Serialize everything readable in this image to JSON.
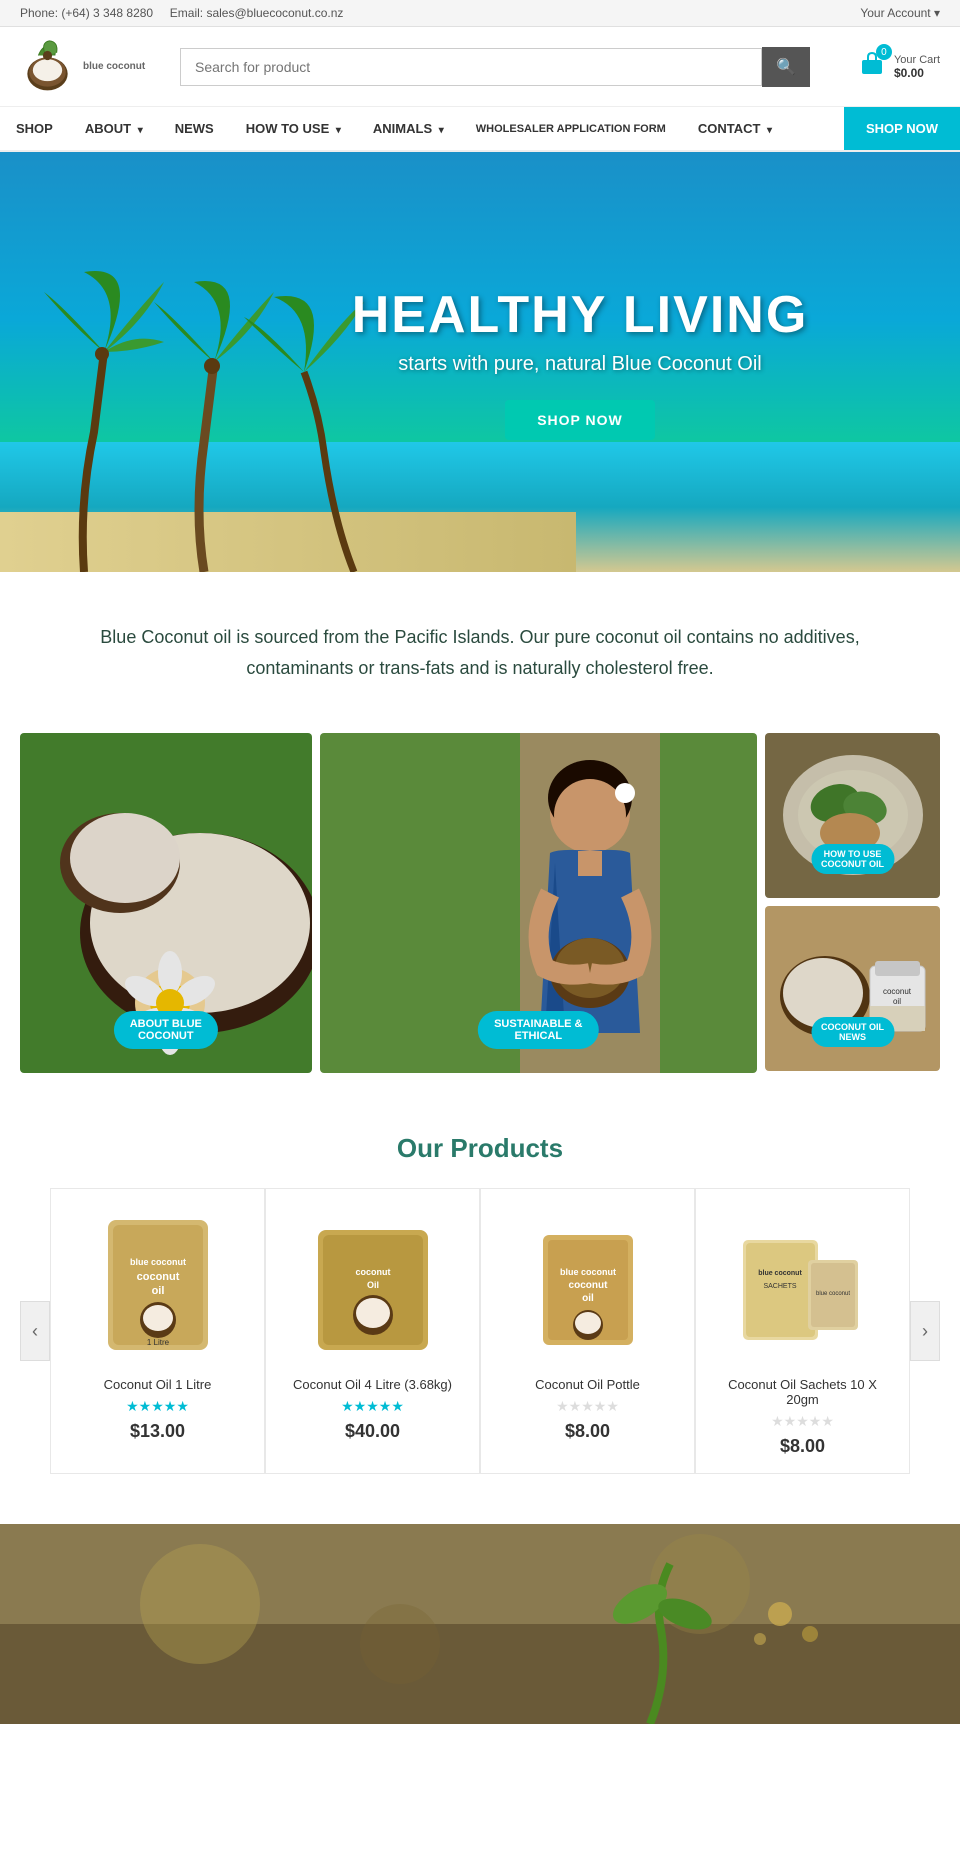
{
  "topbar": {
    "phone": "Phone: (+64) 3 348 8280",
    "email": "Email: sales@bluecoconut.co.nz",
    "account": "Your Account ▾"
  },
  "header": {
    "logo_line1": "blue coconut",
    "cart_label": "Your Cart",
    "cart_amount": "$0.00",
    "cart_count": "0",
    "search_placeholder": "Search for product"
  },
  "nav": {
    "items": [
      {
        "label": "SHOP",
        "has_arrow": false
      },
      {
        "label": "ABOUT",
        "has_arrow": true
      },
      {
        "label": "NEWS",
        "has_arrow": false
      },
      {
        "label": "HOW TO USE",
        "has_arrow": true
      },
      {
        "label": "ANIMALS",
        "has_arrow": true
      },
      {
        "label": "WHOLESALER APPLICATION FORM",
        "has_arrow": false
      },
      {
        "label": "CONTACT",
        "has_arrow": true
      }
    ],
    "shop_now": "SHOP NOW"
  },
  "hero": {
    "title": "HEALTHY LIVING",
    "subtitle": "starts with pure, natural Blue Coconut Oil",
    "button": "SHOP NOW"
  },
  "about": {
    "text": "Blue Coconut oil is sourced from the Pacific Islands. Our pure coconut oil contains no additives, contaminants or trans-fats and is naturally cholesterol free."
  },
  "grid_labels": {
    "about": "ABOUT BLUE\nCOCONUT",
    "sustainable": "SUSTAINABLE &\nETHICAL",
    "how_to_use": "HOW TO USE\nCOCONUT OIL",
    "news": "COCONUT OIL\nNEWS"
  },
  "products": {
    "title": "Our Products",
    "items": [
      {
        "name": "Coconut Oil 1 Litre",
        "price": "$13.00",
        "stars": 5,
        "rated": true,
        "color": "#d4a85a"
      },
      {
        "name": "Coconut Oil 4 Litre (3.68kg)",
        "price": "$40.00",
        "stars": 5,
        "rated": true,
        "color": "#b8934a"
      },
      {
        "name": "Coconut Oil Pottle",
        "price": "$8.00",
        "stars": 0,
        "rated": false,
        "color": "#c9a060"
      },
      {
        "name": "Coconut Oil Sachets 10 X 20gm",
        "price": "$8.00",
        "stars": 0,
        "rated": false,
        "color": "#e8c88a"
      }
    ]
  }
}
